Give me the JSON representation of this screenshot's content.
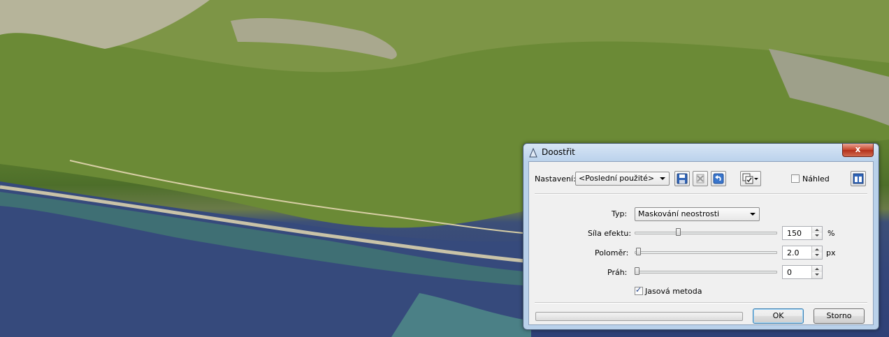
{
  "dialog": {
    "title": "Doostřit",
    "close_label": "x",
    "toolbar": {
      "preset_label": "Nastavení:",
      "preset_value": "<Poslední použité>",
      "save_icon": "floppy-disk-icon",
      "delete_icon": "delete-icon",
      "reset_icon": "undo-icon",
      "options_icon": "checklist-icon",
      "preview_label": "Náhled",
      "preview_checked": false,
      "layout_icon": "split-view-icon"
    },
    "type": {
      "label": "Typ:",
      "value": "Maskování neostrosti"
    },
    "strength": {
      "label": "Síla efektu:",
      "value": "150",
      "unit": "%",
      "fraction": 0.32
    },
    "radius": {
      "label": "Poloměr:",
      "value": "2.0",
      "unit": "px",
      "fraction": 0.02
    },
    "threshold": {
      "label": "Práh:",
      "value": "0",
      "unit": "",
      "fraction": 0.0
    },
    "luminance": {
      "label": "Jasová metoda",
      "checked": true
    },
    "progress": 0,
    "ok_label": "OK",
    "cancel_label": "Storno"
  },
  "colors": {
    "dialog_frame": "#b9d1ea",
    "close_button": "#c7442a",
    "client_bg": "#f0f0f0"
  }
}
